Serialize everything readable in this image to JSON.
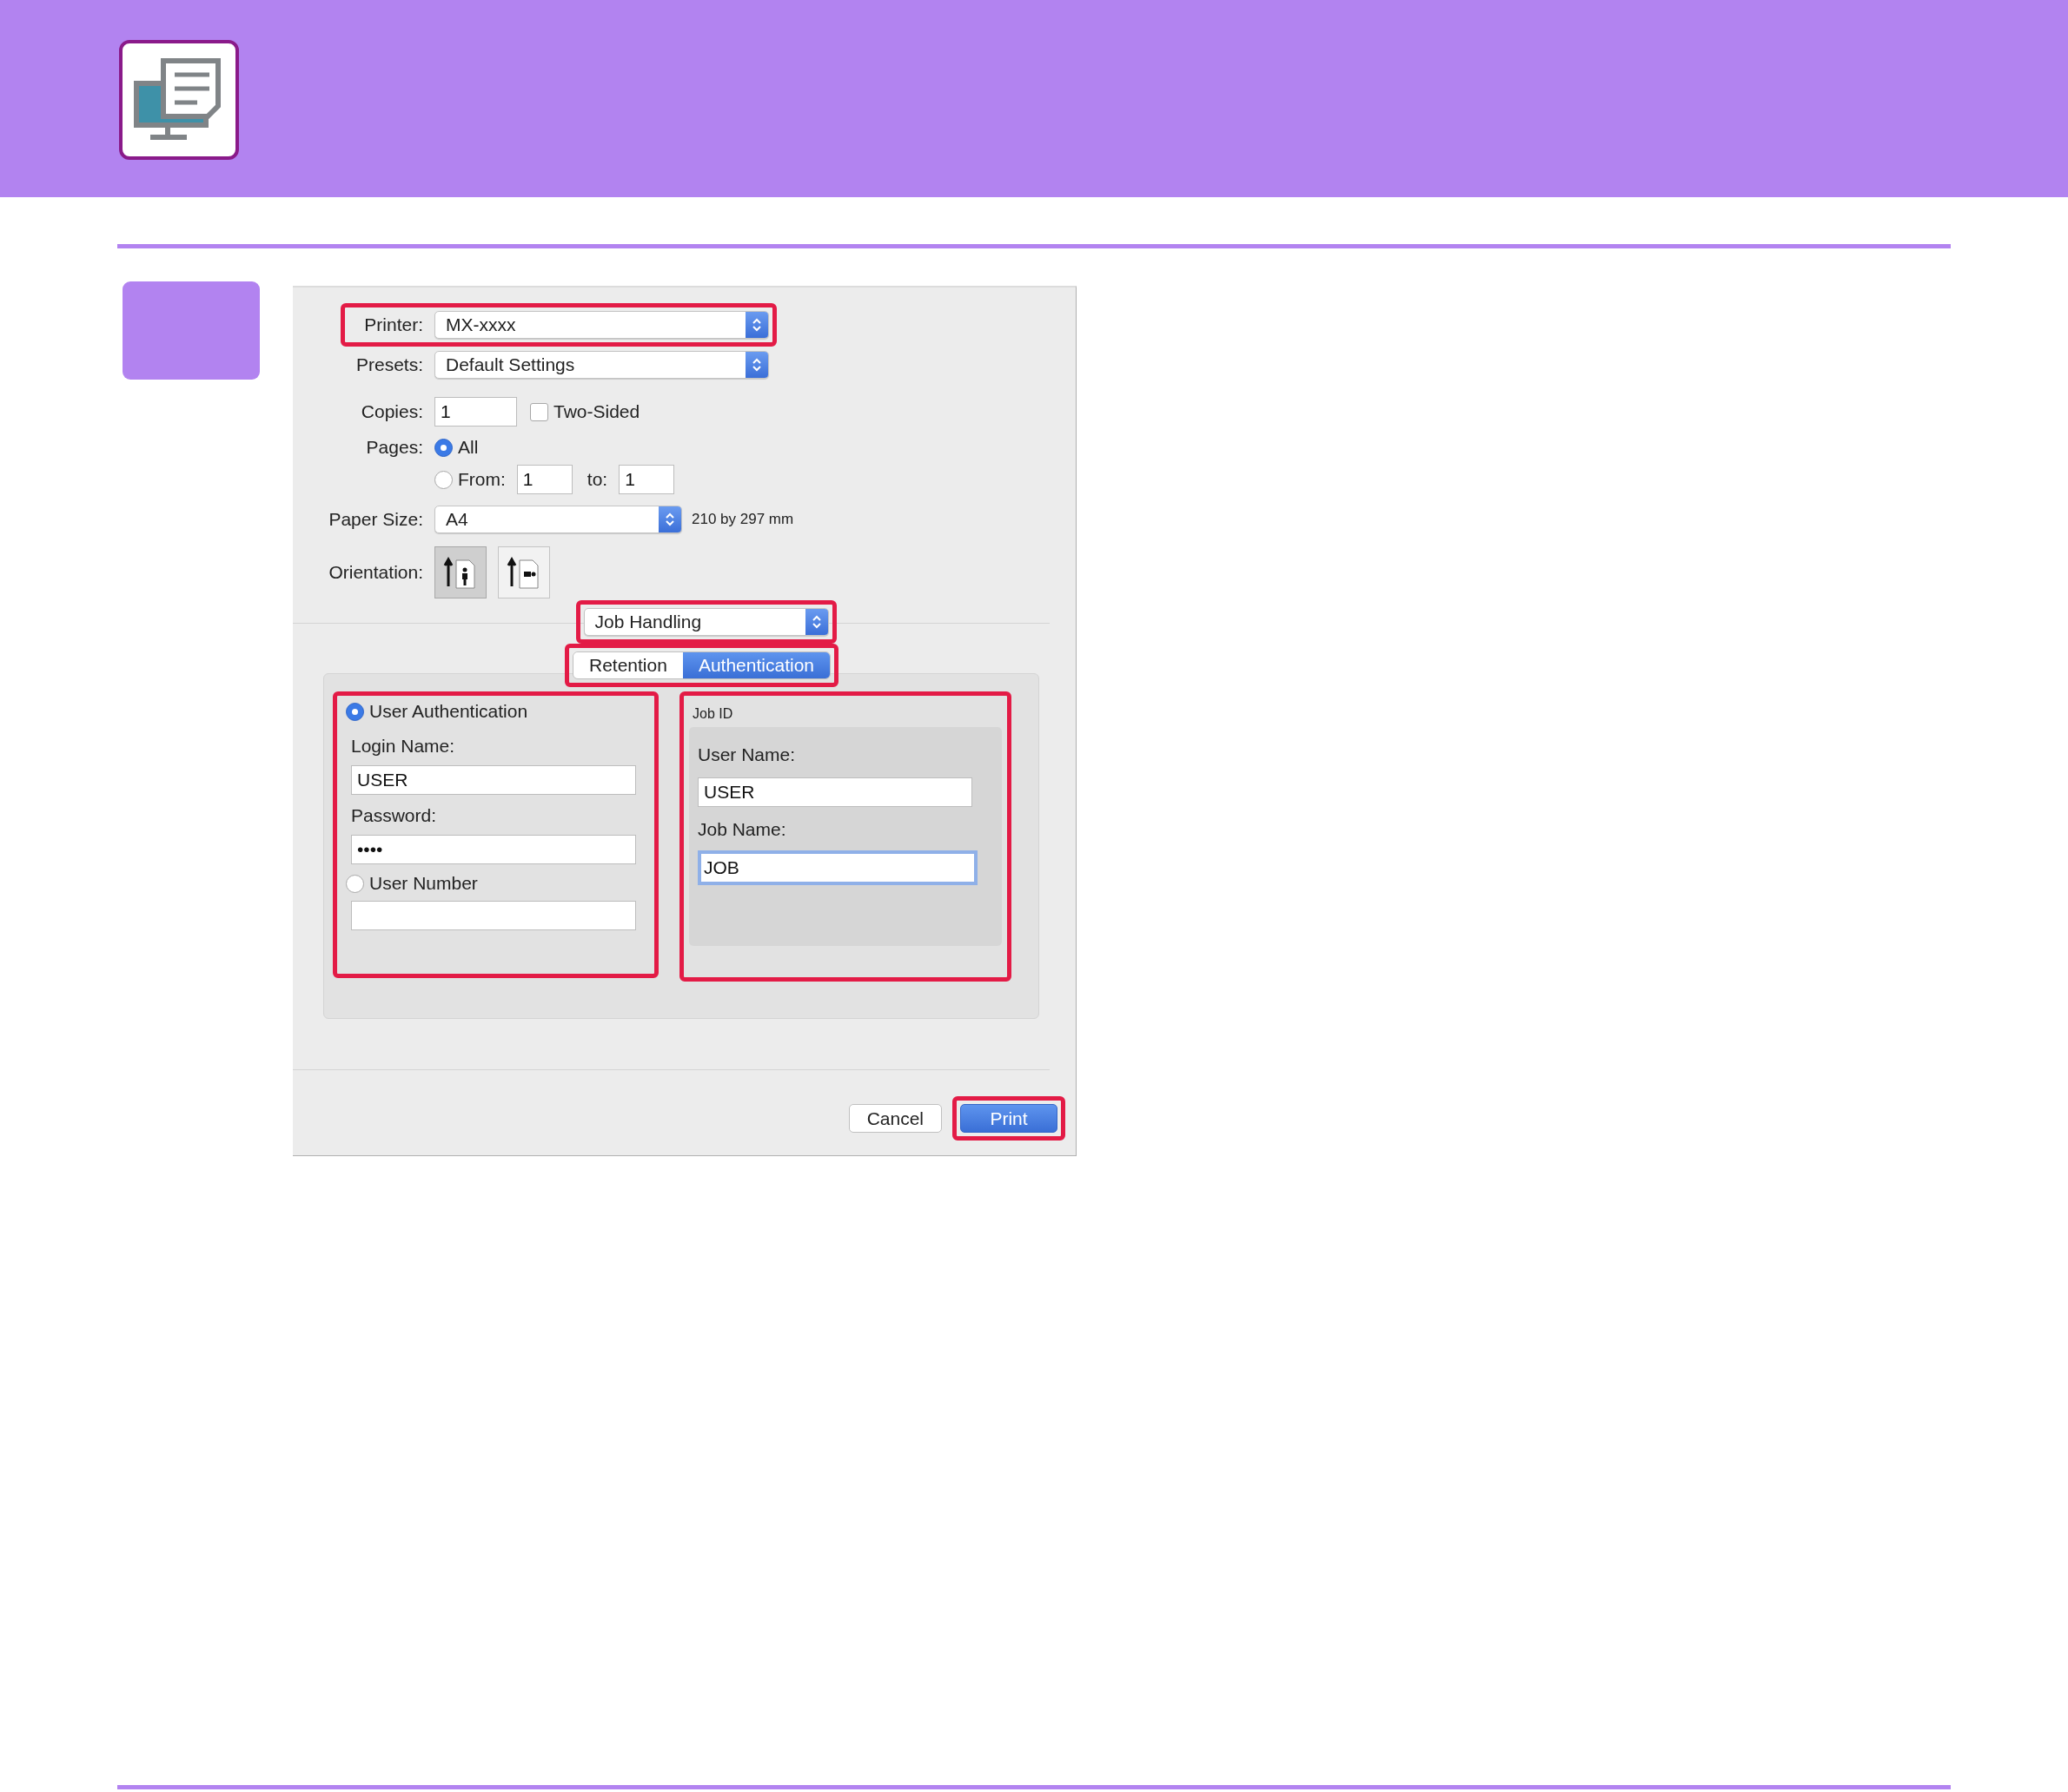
{
  "dialog": {
    "printer": {
      "label": "Printer:",
      "value": "MX-xxxx",
      "highlighted": true
    },
    "presets": {
      "label": "Presets:",
      "value": "Default Settings"
    },
    "copies": {
      "label": "Copies:",
      "value": "1"
    },
    "two_sided": {
      "label": "Two-Sided",
      "checked": false
    },
    "pages": {
      "label": "Pages:",
      "options": [
        {
          "label": "All",
          "selected": true
        },
        {
          "label": "From:",
          "selected": false
        }
      ],
      "from": "1",
      "to_label": "to:",
      "to": "1"
    },
    "paper_size": {
      "label": "Paper Size:",
      "value": "A4",
      "dimensions": "210 by 297 mm"
    },
    "orientation": {
      "label": "Orientation:",
      "options": [
        {
          "kind": "portrait",
          "selected": true
        },
        {
          "kind": "landscape",
          "selected": false
        }
      ]
    },
    "panel_menu": {
      "value": "Job Handling",
      "highlighted": true
    },
    "tabs": {
      "highlighted": true,
      "items": [
        {
          "label": "Retention",
          "selected": false
        },
        {
          "label": "Authentication",
          "selected": true
        }
      ]
    },
    "authentication": {
      "highlighted": true,
      "user_authentication": {
        "label": "User Authentication",
        "selected": true,
        "login_label": "Login Name:",
        "login_value": "USER",
        "password_label": "Password:",
        "password_value": "••••"
      },
      "user_number": {
        "label": "User Number",
        "selected": false
      }
    },
    "job_id": {
      "title": "Job ID",
      "highlighted": true,
      "user_name_label": "User Name:",
      "user_name": "USER",
      "job_name_label": "Job Name:",
      "job_name": "JOB",
      "job_name_focused": true
    },
    "buttons": [
      {
        "label": "Cancel",
        "kind": "secondary",
        "highlighted": false
      },
      {
        "label": "Print",
        "kind": "default",
        "highlighted": true
      }
    ]
  }
}
